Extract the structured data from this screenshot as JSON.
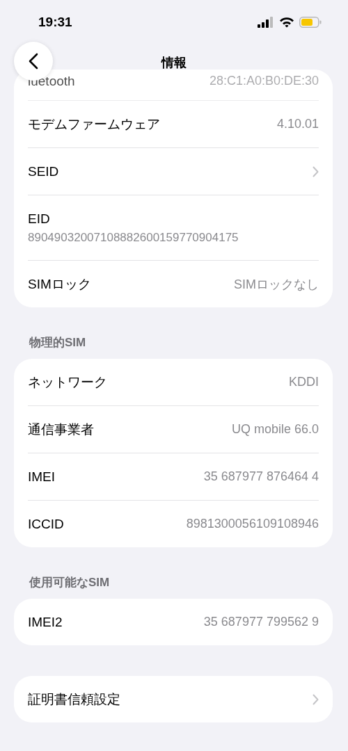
{
  "status_bar": {
    "time": "19:31"
  },
  "nav": {
    "title": "情報"
  },
  "groups": [
    {
      "rows": [
        {
          "kind": "partial",
          "label": "luetooth",
          "value": "28:C1:A0:B0:DE:30"
        },
        {
          "kind": "value",
          "label": "モデムファームウェア",
          "value": "4.10.01"
        },
        {
          "kind": "link",
          "label": "SEID"
        },
        {
          "kind": "stacked",
          "label": "EID",
          "value": "89049032007108882600159770904175"
        },
        {
          "kind": "value",
          "label": "SIMロック",
          "value": "SIMロックなし"
        }
      ]
    },
    {
      "header": "物理的SIM",
      "rows": [
        {
          "kind": "value",
          "label": "ネットワーク",
          "value": "KDDI"
        },
        {
          "kind": "value",
          "label": "通信事業者",
          "value": "UQ mobile 66.0"
        },
        {
          "kind": "value",
          "label": "IMEI",
          "value": "35 687977 876464 4"
        },
        {
          "kind": "value",
          "label": "ICCID",
          "value": "8981300056109108946"
        }
      ]
    },
    {
      "header": "使用可能なSIM",
      "rows": [
        {
          "kind": "value",
          "label": "IMEI2",
          "value": "35 687977 799562 9"
        }
      ]
    },
    {
      "rows": [
        {
          "kind": "link",
          "label": "証明書信頼設定"
        }
      ]
    }
  ]
}
